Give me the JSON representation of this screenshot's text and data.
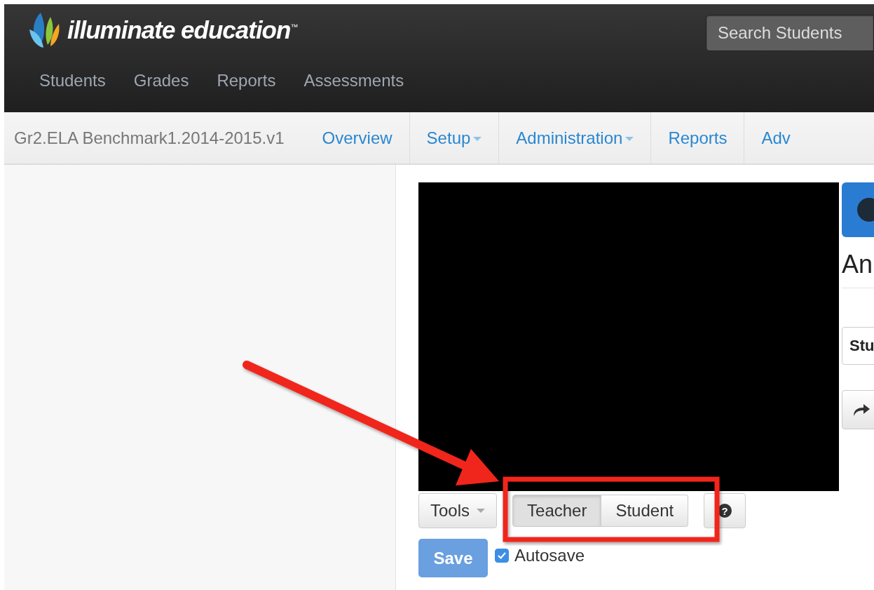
{
  "header": {
    "logo": "illuminate education$^{™}$",
    "search": {
      "placeholder": "Search Students"
    },
    "nav": [
      {
        "label": "Students"
      },
      {
        "label": "Grades"
      },
      {
        "label": "Reports"
      },
      {
        "label": "Assessments"
      }
    ]
  },
  "subnav": {
    "title": "Gr2.ELA Benchmark1.2014-2015.v1",
    "tabs": [
      {
        "label": "Overview",
        "dropdown": false
      },
      {
        "label": "Setup",
        "dropdown": true
      },
      {
        "label": "Administration",
        "dropdown": true
      },
      {
        "label": "Reports",
        "dropdown": false
      },
      {
        "label": "Adv",
        "dropdown": false
      }
    ]
  },
  "toolbar": {
    "tools": {
      "label": "Tools",
      "dropdown": true
    },
    "views": [
      {
        "label": "Teacher",
        "selected": true
      },
      {
        "label": "Student",
        "selected": false
      }
    ],
    "help": {
      "glyph": "?"
    }
  },
  "save": {
    "label": "Save"
  },
  "autosave": {
    "label": "Autosave",
    "checked": true
  },
  "side_panel": {
    "heading": "An",
    "select": "Stu"
  }
}
